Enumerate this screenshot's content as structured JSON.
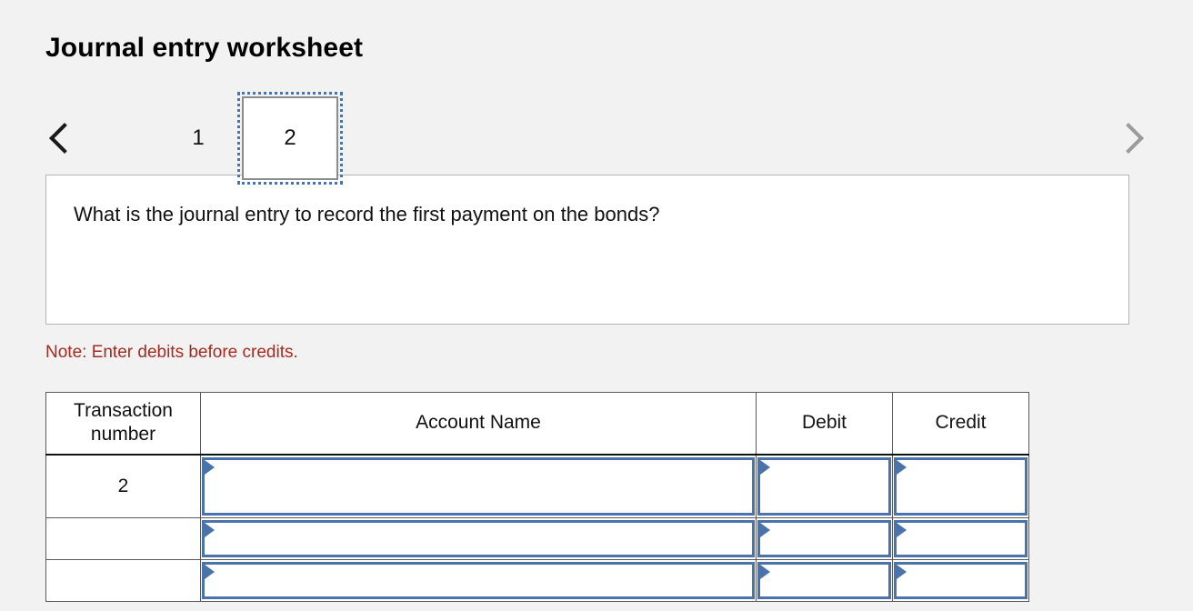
{
  "page": {
    "title": "Journal entry worksheet",
    "background_color": "#f2f2f2"
  },
  "pager": {
    "prev_icon": "chevron-left-icon",
    "next_icon": "chevron-right-icon",
    "prev_enabled_color": "#1a1a1a",
    "next_disabled_color": "#9b9b9b",
    "tabs": [
      {
        "label": "1",
        "selected": false
      },
      {
        "label": "2",
        "selected": true
      }
    ],
    "focus_outline_color": "#4a72ab"
  },
  "question": {
    "text": "What is the journal entry to record the first payment on the bonds?",
    "border_color": "#b4b4b4",
    "background_color": "#ffffff"
  },
  "note": {
    "text": "Note: Enter debits before credits.",
    "color": "#a32b20"
  },
  "journal": {
    "accent_color": "#4a72ab",
    "headers": {
      "transaction_number": "Transaction number",
      "account_name": "Account Name",
      "debit": "Debit",
      "credit": "Credit"
    },
    "rows": [
      {
        "transaction_number": "2",
        "account_name": "",
        "debit": "",
        "credit": "",
        "placeholder_account": "",
        "placeholder_debit": "",
        "placeholder_credit": ""
      },
      {
        "transaction_number": "",
        "account_name": "",
        "debit": "",
        "credit": "",
        "placeholder_account": "",
        "placeholder_debit": "",
        "placeholder_credit": ""
      },
      {
        "transaction_number": "",
        "account_name": "",
        "debit": "",
        "credit": "",
        "placeholder_account": "",
        "placeholder_debit": "",
        "placeholder_credit": ""
      }
    ]
  }
}
